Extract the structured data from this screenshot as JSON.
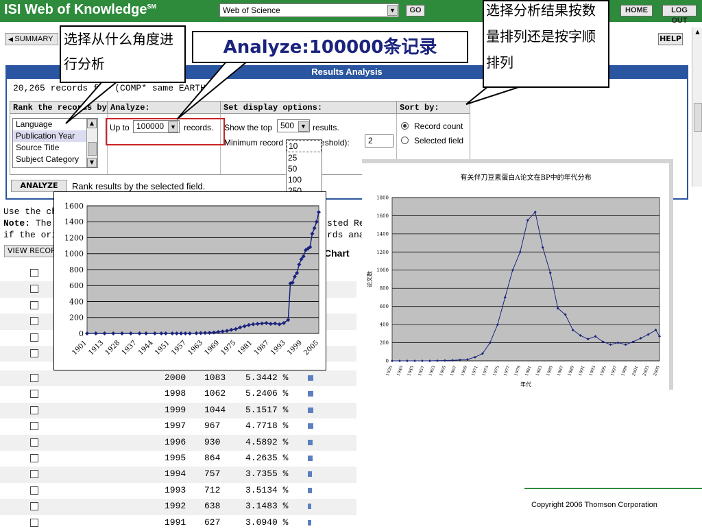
{
  "header": {
    "brand": "ISI Web of Knowledge",
    "brand_mark": "SM",
    "database_select": "Web of Science",
    "go_label": "GO",
    "home_label": "HOME",
    "logout_label": "LOG OUT"
  },
  "subheader": {
    "summary_label": "SUMMARY",
    "help_label": "HELP"
  },
  "panel": {
    "title": "Results Analysis",
    "count_text": "20,265 records for (COMP* same EARTH)",
    "rank_header": "Rank the records by:",
    "analyze_header": "Analyze:",
    "display_header": "Set display options:",
    "sort_header": "Sort by:",
    "rank_options": [
      "Language",
      "Publication Year",
      "Source Title",
      "Subject Category"
    ],
    "analyze_prefix": "Up to",
    "analyze_value": "100000",
    "analyze_suffix": "records.",
    "show_top_prefix": "Show the top",
    "show_top_value": "500",
    "show_top_suffix": "results.",
    "min_record_label": "Minimum record count (threshold):",
    "min_record_value": "2",
    "display_options": [
      "10",
      "25",
      "50",
      "100",
      "250"
    ],
    "sort_record_count": "Record count",
    "sort_selected_field": "Selected field",
    "analyze_button": "ANALYZE",
    "analyze_hint": "Rank results by the selected field."
  },
  "body": {
    "use_line": "Use the ch",
    "note_label": "Note:",
    "note_line": "The",
    "note_right": "sted Re",
    "origin_line": "if the origi",
    "origin_right": "rds ana",
    "view_button": "VIEW RECORDS",
    "chart_link": "Chart"
  },
  "table_rows": [
    {
      "year": "2000",
      "count": "1083",
      "percent": "5.3442 %",
      "bar": 0.53
    },
    {
      "year": "1998",
      "count": "1062",
      "percent": "5.2406 %",
      "bar": 0.52
    },
    {
      "year": "1999",
      "count": "1044",
      "percent": "5.1517 %",
      "bar": 0.51
    },
    {
      "year": "1997",
      "count": "967",
      "percent": "4.7718 %",
      "bar": 0.48
    },
    {
      "year": "1996",
      "count": "930",
      "percent": "4.5892 %",
      "bar": 0.46
    },
    {
      "year": "1995",
      "count": "864",
      "percent": "4.2635 %",
      "bar": 0.43
    },
    {
      "year": "1994",
      "count": "757",
      "percent": "3.7355 %",
      "bar": 0.37
    },
    {
      "year": "1993",
      "count": "712",
      "percent": "3.5134 %",
      "bar": 0.35
    },
    {
      "year": "1992",
      "count": "638",
      "percent": "3.1483 %",
      "bar": 0.31
    },
    {
      "year": "1991",
      "count": "627",
      "percent": "3.0940 %",
      "bar": 0.31
    }
  ],
  "callouts": {
    "angle": "选择从什么角度进行分析",
    "analyze": "Analyze:100000条记录",
    "sort": "选择分析结果按数量排列还是按字顺排列"
  },
  "copyright": "Copyright 2006 Thomson Corporation",
  "colors": {
    "header": "#2e8b3c",
    "panel_border": "#2a55a0",
    "series": "#1a237e",
    "highlight": "#cc2222"
  },
  "chart_data": [
    {
      "type": "line",
      "title": "",
      "xlabel": "",
      "ylabel": "",
      "ylim": [
        0,
        1600
      ],
      "yticks": [
        0,
        200,
        400,
        600,
        800,
        1000,
        1200,
        1400,
        1600
      ],
      "xticks": [
        "1901",
        "1913",
        "1928",
        "1937",
        "1944",
        "1951",
        "1957",
        "1963",
        "1969",
        "1975",
        "1981",
        "1987",
        "1993",
        "1999",
        "2005"
      ],
      "x": [
        1901,
        1905,
        1909,
        1913,
        1917,
        1921,
        1925,
        1928,
        1932,
        1935,
        1937,
        1940,
        1942,
        1944,
        1946,
        1948,
        1951,
        1953,
        1955,
        1957,
        1959,
        1961,
        1963,
        1965,
        1967,
        1969,
        1971,
        1973,
        1975,
        1977,
        1979,
        1981,
        1983,
        1985,
        1987,
        1989,
        1991,
        1993,
        1994,
        1995,
        1996,
        1997,
        1998,
        1999,
        2000,
        2001,
        2002,
        2003,
        2004,
        2005,
        2006,
        2007
      ],
      "values": [
        0,
        0,
        0,
        0,
        0,
        0,
        0,
        0,
        0,
        0,
        0,
        0,
        0,
        0,
        0,
        0,
        2,
        4,
        6,
        8,
        12,
        18,
        25,
        32,
        45,
        55,
        75,
        90,
        105,
        115,
        120,
        125,
        130,
        120,
        125,
        115,
        130,
        170,
        627,
        638,
        712,
        757,
        864,
        930,
        967,
        1044,
        1062,
        1083,
        1250,
        1320,
        1400,
        1520
      ],
      "grid": true
    },
    {
      "type": "line",
      "title": "有关伴刀豆素蛋白A论文在BP中的年代分布",
      "xlabel": "年代",
      "ylabel": "论文数",
      "ylim": [
        0,
        1800
      ],
      "yticks": [
        0,
        200,
        400,
        600,
        800,
        1000,
        1200,
        1400,
        1600,
        1800
      ],
      "xticks": [
        "1935",
        "1940",
        "1945",
        "1957",
        "1963",
        "1965",
        "1967",
        "1969",
        "1971",
        "1973",
        "1975",
        "1977",
        "1979",
        "1981",
        "1983",
        "1985",
        "1987",
        "1989",
        "1991",
        "1993",
        "1995",
        "1997",
        "1999",
        "2001",
        "2003",
        "2005"
      ],
      "x": [
        1935,
        1937,
        1939,
        1941,
        1943,
        1945,
        1947,
        1949,
        1951,
        1953,
        1955,
        1957,
        1959,
        1961,
        1963,
        1965,
        1967,
        1969,
        1971,
        1973,
        1975,
        1977,
        1979,
        1981,
        1983,
        1985,
        1987,
        1989,
        1991,
        1993,
        1995,
        1997,
        1999,
        2001,
        2003,
        2005,
        2006
      ],
      "values": [
        0,
        0,
        0,
        0,
        0,
        0,
        2,
        4,
        6,
        10,
        15,
        40,
        80,
        200,
        400,
        700,
        1000,
        1200,
        1550,
        1640,
        1250,
        970,
        580,
        510,
        340,
        280,
        240,
        270,
        210,
        180,
        200,
        180,
        210,
        250,
        290,
        340,
        270
      ],
      "grid": true
    }
  ]
}
